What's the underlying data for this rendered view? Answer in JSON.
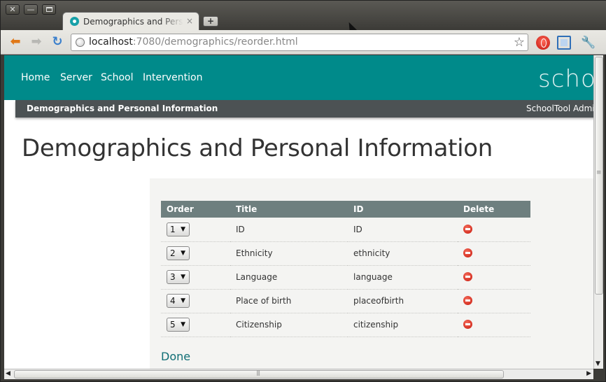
{
  "browser": {
    "tab_title": "Demographics and Personal Information",
    "tab_close": "×",
    "new_tab": "+",
    "url_host": "localhost",
    "url_rest": ":7080/demographics/reorder.html",
    "window_controls": {
      "close": "✕",
      "minimize": "—"
    },
    "icons": [
      "back-arrow-icon",
      "forward-arrow-icon",
      "reload-icon",
      "globe-icon",
      "bookmark-star-icon",
      "opera-icon",
      "fullscreen-icon",
      "wrench-icon"
    ]
  },
  "site": {
    "nav": [
      "Home",
      "Server",
      "School",
      "Intervention"
    ],
    "brand": "schoo",
    "breadcrumb": "Demographics and Personal Information",
    "user": "SchoolTool Administrator",
    "accent": "#008a8a"
  },
  "page": {
    "title": "Demographics and Personal Information",
    "table": {
      "headers": {
        "order": "Order",
        "title": "Title",
        "id": "ID",
        "delete": "Delete"
      },
      "rows": [
        {
          "order": "1",
          "title": "ID",
          "id": "ID"
        },
        {
          "order": "2",
          "title": "Ethnicity",
          "id": "ethnicity"
        },
        {
          "order": "3",
          "title": "Language",
          "id": "language"
        },
        {
          "order": "4",
          "title": "Place of birth",
          "id": "placeofbirth"
        },
        {
          "order": "5",
          "title": "Citizenship",
          "id": "citizenship"
        }
      ]
    },
    "done_label": "Done"
  }
}
